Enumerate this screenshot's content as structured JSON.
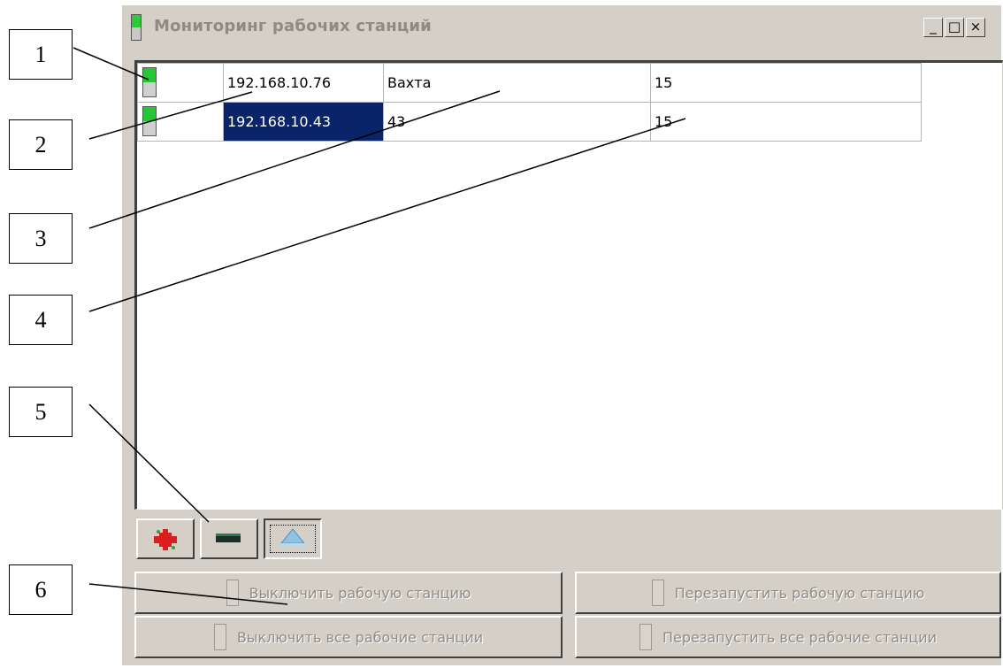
{
  "window": {
    "title": "Мониторинг рабочих станций",
    "controls": {
      "minimize": "_",
      "maximize": "□",
      "close": "×"
    }
  },
  "stations": [
    {
      "status": "online",
      "ip": "192.168.10.76",
      "name": "Вахта",
      "value": "15",
      "selected": false
    },
    {
      "status": "online",
      "ip": "192.168.10.43",
      "name": "43",
      "value": "15",
      "selected": true
    }
  ],
  "toolbar": {
    "add_icon": "red-plus-icon",
    "remove_icon": "dark-minus-icon",
    "up_icon": "triangle-up-icon"
  },
  "buttons": {
    "shutdown": "Выключить рабочую станцию",
    "restart": "Перезапустить рабочую станцию",
    "shutdown_all": "Выключить все рабочие станции",
    "restart_all": "Перезапустить все рабочие станции"
  },
  "callouts": [
    "1",
    "2",
    "3",
    "4",
    "5",
    "6"
  ],
  "colors": {
    "selection": "#0a246a",
    "indicator_on": "#26c637",
    "window_bg": "#d4d0c8"
  }
}
